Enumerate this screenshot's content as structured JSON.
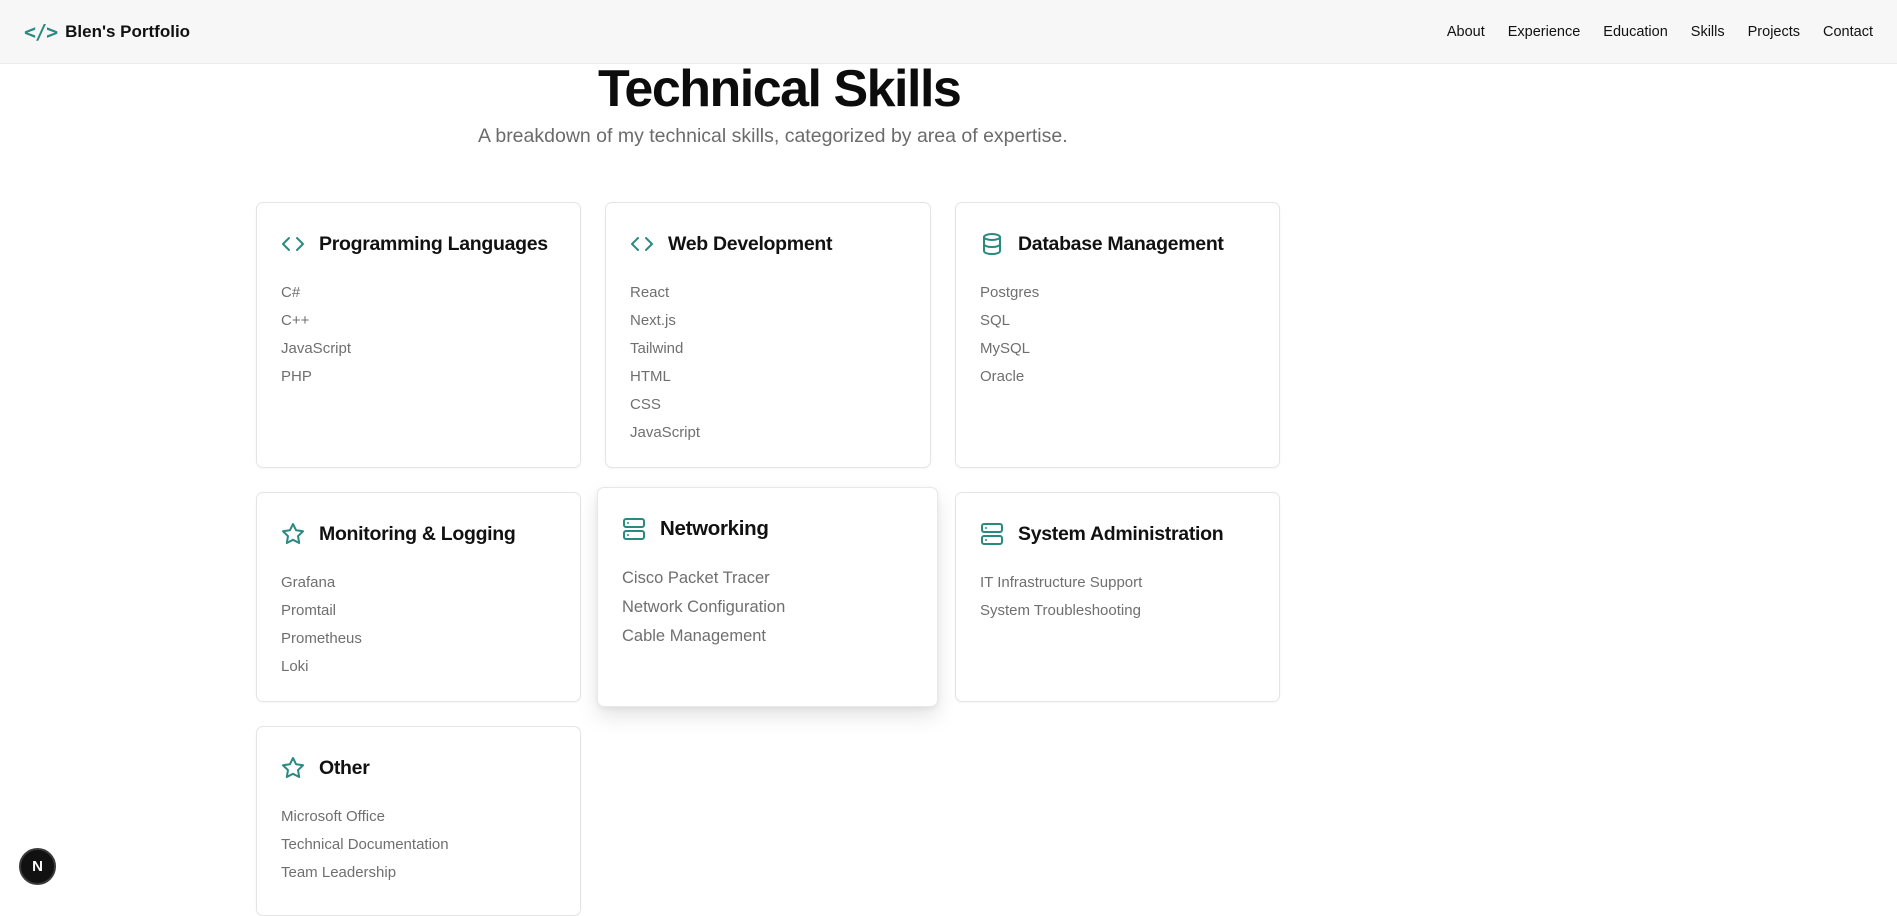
{
  "header": {
    "brand_icon": "</>",
    "brand_name": "Blen's Portfolio",
    "nav": [
      "About",
      "Experience",
      "Education",
      "Skills",
      "Projects",
      "Contact"
    ]
  },
  "skills_section": {
    "title": "Technical Skills",
    "subtitle": "A breakdown of my technical skills, categorized by area of expertise.",
    "accent_color": "#2a8a82",
    "categories": [
      {
        "title": "Programming Languages",
        "icon": "code-icon",
        "items": [
          "C#",
          "C++",
          "JavaScript",
          "PHP"
        ]
      },
      {
        "title": "Web Development",
        "icon": "code-icon",
        "items": [
          "React",
          "Next.js",
          "Tailwind",
          "HTML",
          "CSS",
          "JavaScript"
        ]
      },
      {
        "title": "Database Management",
        "icon": "database-icon",
        "items": [
          "Postgres",
          "SQL",
          "MySQL",
          "Oracle"
        ]
      },
      {
        "title": "Monitoring & Logging",
        "icon": "star-icon",
        "items": [
          "Grafana",
          "Promtail",
          "Prometheus",
          "Loki"
        ]
      },
      {
        "title": "Networking",
        "icon": "server-icon",
        "items": [
          "Cisco Packet Tracer",
          "Network Configuration",
          "Cable Management"
        ]
      },
      {
        "title": "System Administration",
        "icon": "server-icon",
        "items": [
          "IT Infrastructure Support",
          "System Troubleshooting"
        ]
      },
      {
        "title": "Other",
        "icon": "star-icon",
        "items": [
          "Microsoft Office",
          "Technical Documentation",
          "Team Leadership"
        ]
      }
    ]
  },
  "dev_badge": "N"
}
